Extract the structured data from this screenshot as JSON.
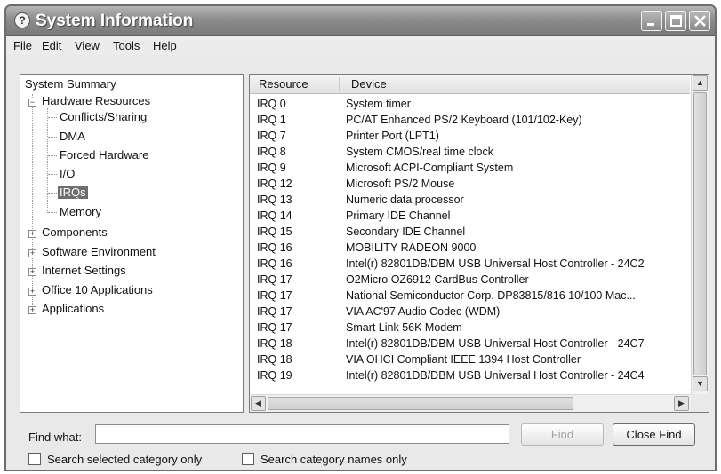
{
  "window": {
    "title": "System Information",
    "app_icon": "help-circle-icon"
  },
  "menubar": [
    "File",
    "Edit",
    "View",
    "Tools",
    "Help"
  ],
  "tree": {
    "root": "System Summary",
    "hardware": {
      "label": "Hardware Resources",
      "children": [
        "Conflicts/Sharing",
        "DMA",
        "Forced Hardware",
        "I/O",
        "IRQs",
        "Memory"
      ],
      "selected": "IRQs"
    },
    "collapsed": [
      "Components",
      "Software Environment",
      "Internet Settings",
      "Office 10 Applications",
      "Applications"
    ]
  },
  "list": {
    "columns": [
      "Resource",
      "Device"
    ],
    "rows": [
      {
        "resource": "IRQ 0",
        "device": "System timer"
      },
      {
        "resource": "IRQ 1",
        "device": "PC/AT Enhanced PS/2 Keyboard (101/102-Key)"
      },
      {
        "resource": "IRQ 7",
        "device": "Printer Port (LPT1)"
      },
      {
        "resource": "IRQ 8",
        "device": "System CMOS/real time clock"
      },
      {
        "resource": "IRQ 9",
        "device": "Microsoft ACPI-Compliant System"
      },
      {
        "resource": "IRQ 12",
        "device": "Microsoft PS/2 Mouse"
      },
      {
        "resource": "IRQ 13",
        "device": "Numeric data processor"
      },
      {
        "resource": "IRQ 14",
        "device": "Primary IDE Channel"
      },
      {
        "resource": "IRQ 15",
        "device": "Secondary IDE Channel"
      },
      {
        "resource": "IRQ 16",
        "device": "MOBILITY RADEON 9000"
      },
      {
        "resource": "IRQ 16",
        "device": "Intel(r) 82801DB/DBM USB Universal Host Controller - 24C2"
      },
      {
        "resource": "IRQ 17",
        "device": "O2Micro OZ6912 CardBus Controller"
      },
      {
        "resource": "IRQ 17",
        "device": "National Semiconductor Corp. DP83815/816 10/100 Mac..."
      },
      {
        "resource": "IRQ 17",
        "device": "VIA AC'97 Audio Codec (WDM)"
      },
      {
        "resource": "IRQ 17",
        "device": "Smart Link 56K Modem"
      },
      {
        "resource": "IRQ 18",
        "device": "Intel(r) 82801DB/DBM USB Universal Host Controller - 24C7"
      },
      {
        "resource": "IRQ 18",
        "device": "VIA OHCI Compliant IEEE 1394 Host Controller"
      },
      {
        "resource": "IRQ 19",
        "device": "Intel(r) 82801DB/DBM USB Universal Host Controller - 24C4"
      }
    ]
  },
  "find": {
    "label": "Find what:",
    "value": "",
    "find_button": "Find",
    "close_button": "Close Find",
    "check_selected": "Search selected category only",
    "check_names": "Search category names only"
  }
}
